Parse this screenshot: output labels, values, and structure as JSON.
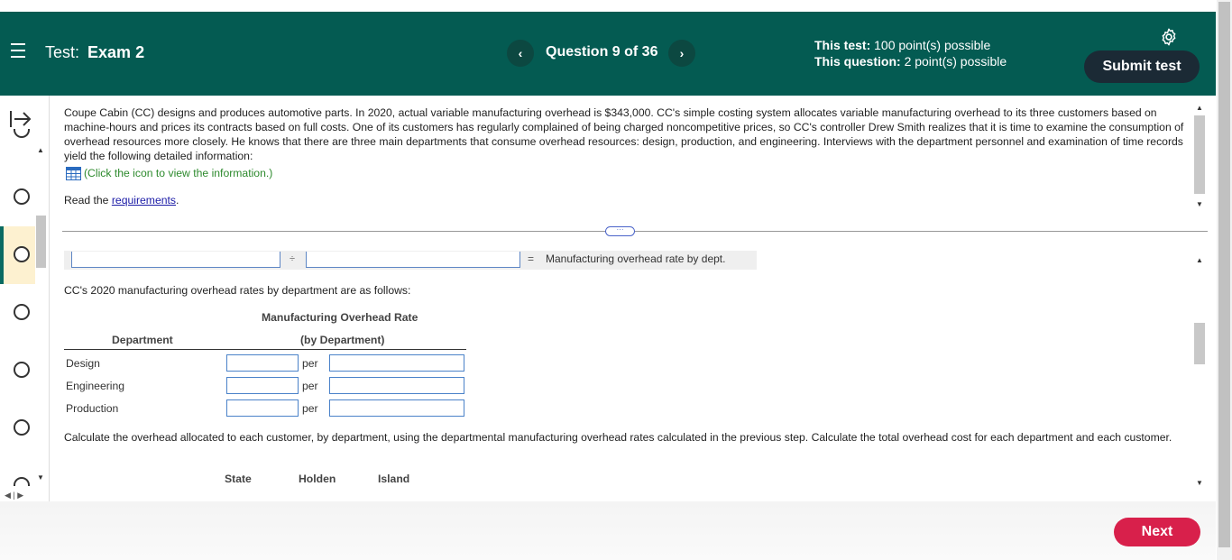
{
  "header": {
    "test_label": "Test:",
    "test_name": "Exam 2",
    "question_label": "Question 9 of 36",
    "prev_glyph": "‹",
    "next_glyph": "›",
    "this_test_label": "This test:",
    "this_test_value": "100 point(s) possible",
    "this_question_label": "This question:",
    "this_question_value": "2 point(s) possible",
    "submit_label": "Submit test"
  },
  "problem": {
    "text": "Coupe Cabin (CC) designs and produces automotive parts. In 2020, actual variable manufacturing overhead is $343,000. CC's simple costing system allocates variable manufacturing overhead to its three customers based on machine-hours and prices its contracts based on full costs. One of its customers has regularly complained of being charged noncompetitive prices, so CC's controller Drew Smith realizes that it is time to examine the consumption of overhead resources more closely. He knows that there are three main departments that consume overhead resources: design, production, and engineering. Interviews with the department personnel and examination of time records yield the following detailed information:",
    "click_info": "(Click the icon to view the information.)",
    "read_prefix": "Read the ",
    "read_link": "requirements",
    "read_suffix": "."
  },
  "formula": {
    "divide_symbol": "÷",
    "equals_symbol": "=",
    "result_label": "Manufacturing overhead rate by dept."
  },
  "rates": {
    "intro": "CC's 2020 manufacturing overhead rates by department are as follows:",
    "col_head_line1": "Manufacturing Overhead Rate",
    "col_head_line2": "(by Department)",
    "dept_head": "Department",
    "per_label": "per",
    "rows": [
      {
        "department": "Design"
      },
      {
        "department": "Engineering"
      },
      {
        "department": "Production"
      }
    ]
  },
  "calc": {
    "text": "Calculate the overhead allocated to each customer, by department, using the departmental manufacturing overhead rates calculated in the previous step. Calculate the total overhead cost for each department and each customer.",
    "customers": [
      "State",
      "Holden",
      "Island"
    ]
  },
  "footer": {
    "next_label": "Next"
  },
  "colors": {
    "header_bg": "#045b52",
    "submit_bg": "#1b2a35",
    "next_bg": "#d8204b",
    "link": "#1a1aa6",
    "info_green": "#2d8a2d"
  }
}
